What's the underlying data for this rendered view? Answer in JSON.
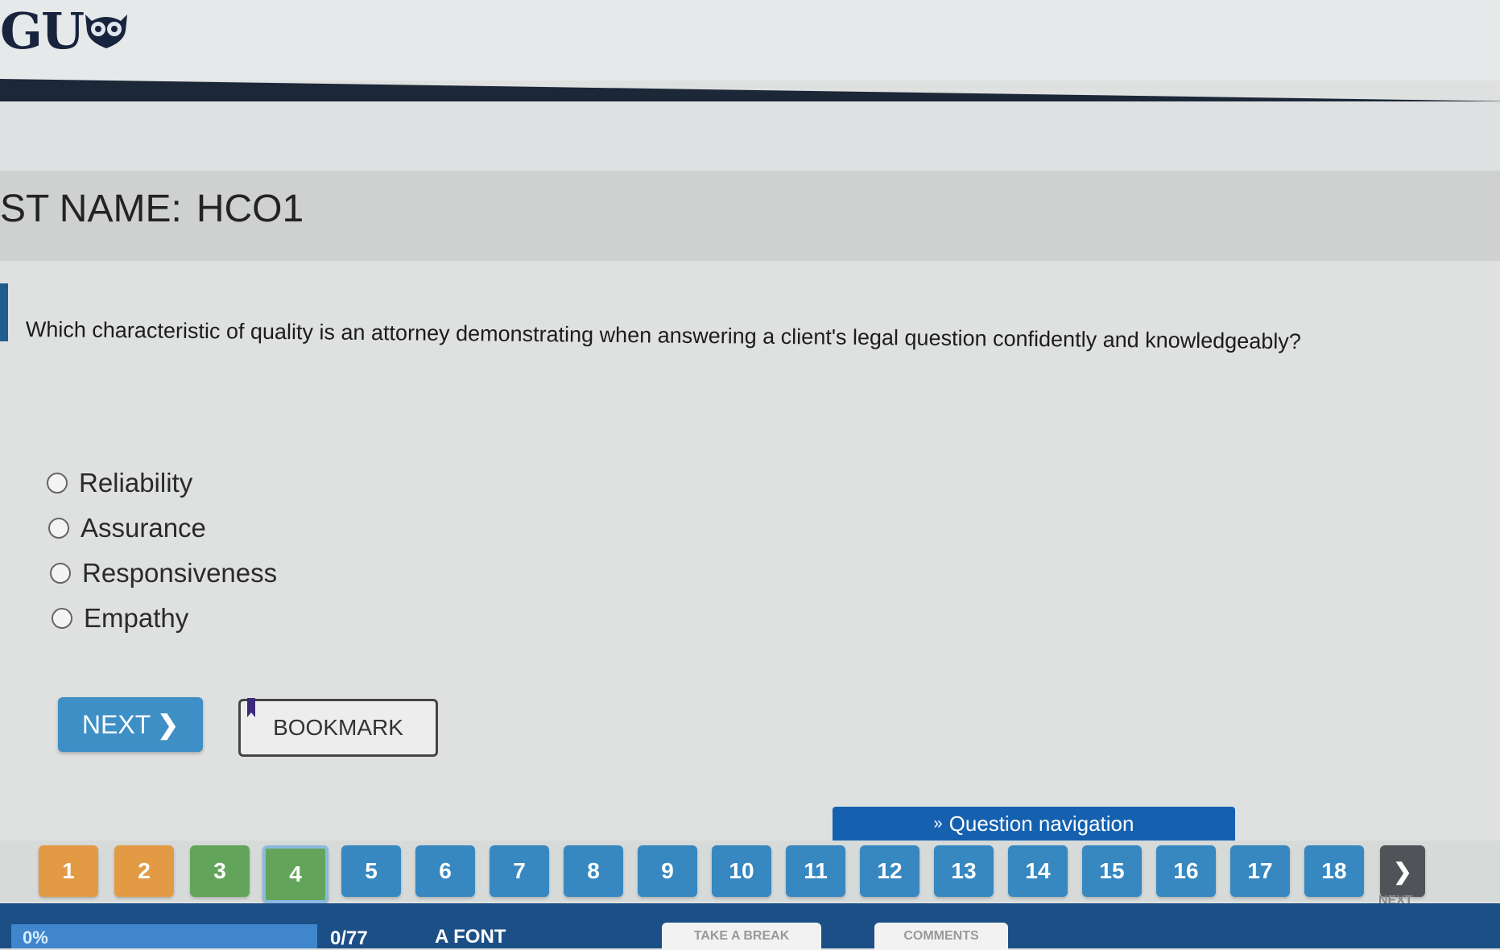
{
  "header": {
    "logo_text": "GU"
  },
  "test": {
    "label": "ST NAME:",
    "name": "HCO1"
  },
  "question": {
    "text": "Which characteristic of quality is an attorney demonstrating when answering a client's legal question confidently and knowledgeably?",
    "options": [
      {
        "label": "Reliability",
        "selected": false
      },
      {
        "label": "Assurance",
        "selected": false
      },
      {
        "label": "Responsiveness",
        "selected": false
      },
      {
        "label": "Empathy",
        "selected": false
      }
    ]
  },
  "buttons": {
    "next_label": "NEXT",
    "bookmark_label": "BOOKMARK"
  },
  "navigation": {
    "toggle_label": "Question navigation",
    "next_label": "NEXT",
    "questions": [
      {
        "number": "1",
        "state": "orange"
      },
      {
        "number": "2",
        "state": "orange"
      },
      {
        "number": "3",
        "state": "green"
      },
      {
        "number": "4",
        "state": "current"
      },
      {
        "number": "5",
        "state": "unanswered"
      },
      {
        "number": "6",
        "state": "unanswered"
      },
      {
        "number": "7",
        "state": "unanswered"
      },
      {
        "number": "8",
        "state": "unanswered"
      },
      {
        "number": "9",
        "state": "unanswered"
      },
      {
        "number": "10",
        "state": "unanswered"
      },
      {
        "number": "11",
        "state": "unanswered"
      },
      {
        "number": "12",
        "state": "unanswered"
      },
      {
        "number": "13",
        "state": "unanswered"
      },
      {
        "number": "14",
        "state": "unanswered"
      },
      {
        "number": "15",
        "state": "unanswered"
      },
      {
        "number": "16",
        "state": "unanswered"
      },
      {
        "number": "17",
        "state": "unanswered"
      },
      {
        "number": "18",
        "state": "unanswered"
      }
    ]
  },
  "footer": {
    "progress_text": "0%",
    "progress_value": 0,
    "counter": "0/77",
    "font_label": "FONT",
    "take_break_label": "TAKE A BREAK",
    "comments_label": "COMMENTS"
  },
  "colors": {
    "primary_blue": "#3788c1",
    "answered_orange": "#e39a44",
    "answered_green": "#62a55a",
    "footer_blue": "#1c4f86"
  }
}
